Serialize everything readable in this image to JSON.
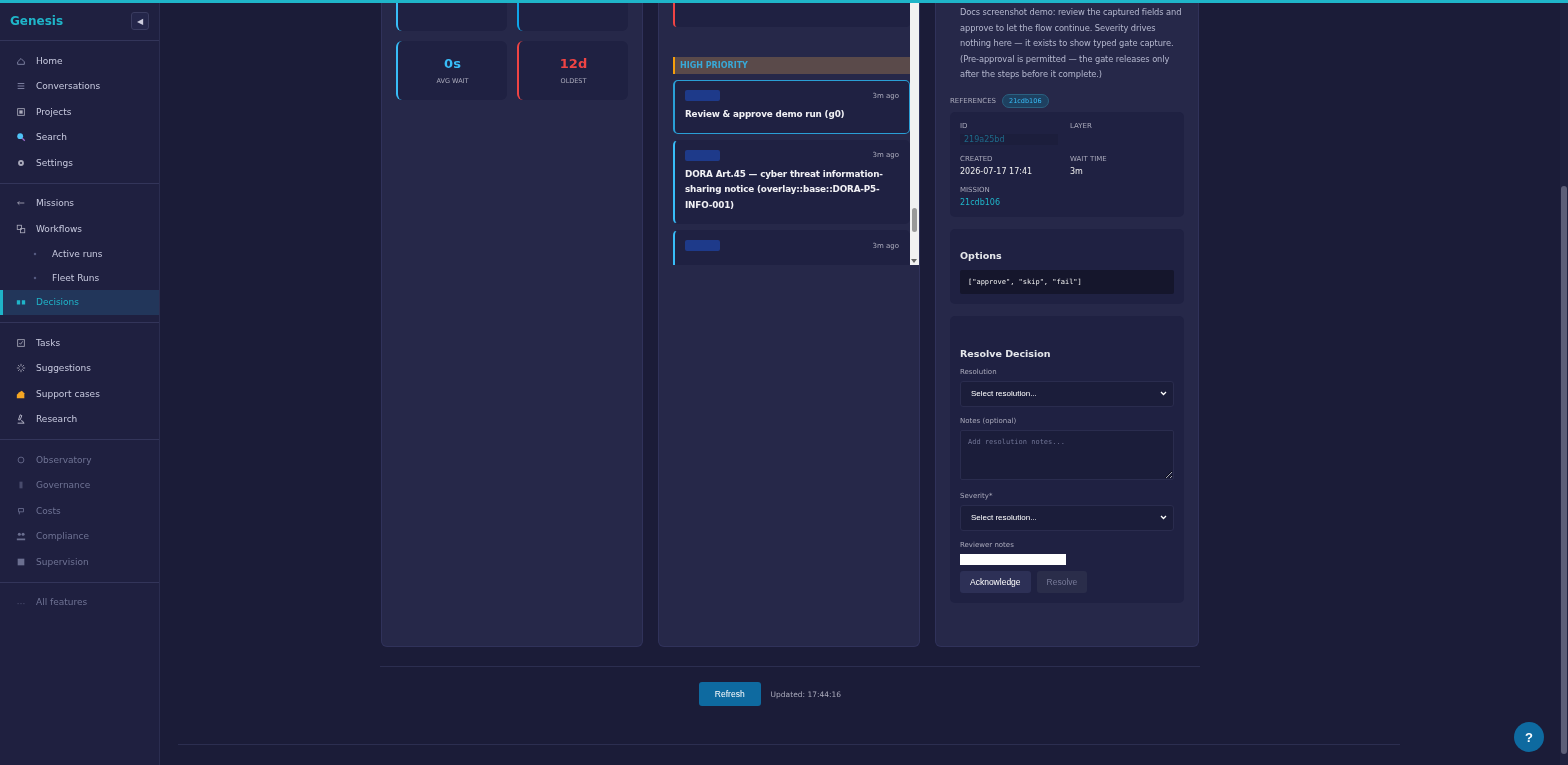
{
  "sidebar": {
    "brand": "Genesis",
    "collapse_glyph": "◀",
    "groups": [
      {
        "items": [
          {
            "label": "Home",
            "selected": false,
            "disabled": false
          },
          {
            "label": "Conversations",
            "selected": false,
            "disabled": false
          },
          {
            "label": "Projects",
            "selected": false,
            "disabled": false
          },
          {
            "label": "Search",
            "selected": false,
            "disabled": false
          },
          {
            "label": "Settings",
            "selected": false,
            "disabled": false
          }
        ]
      },
      {
        "items": [
          {
            "label": "Missions",
            "selected": false,
            "disabled": false
          },
          {
            "label": "Workflows",
            "selected": false,
            "disabled": false,
            "children": [
              {
                "label": "Active runs",
                "selected": false,
                "disabled": false
              },
              {
                "label": "Fleet Runs",
                "selected": false,
                "disabled": false
              }
            ]
          },
          {
            "label": "Decisions",
            "selected": true,
            "disabled": false
          }
        ]
      },
      {
        "items": [
          {
            "label": "Tasks",
            "selected": false,
            "disabled": false
          },
          {
            "label": "Suggestions",
            "selected": false,
            "disabled": false
          },
          {
            "label": "Support cases",
            "selected": false,
            "disabled": false
          },
          {
            "label": "Research",
            "selected": false,
            "disabled": false
          }
        ]
      },
      {
        "items": [
          {
            "label": "Observatory",
            "selected": false,
            "disabled": true
          },
          {
            "label": "Governance",
            "selected": false,
            "disabled": true
          },
          {
            "label": "Costs",
            "selected": false,
            "disabled": true
          },
          {
            "label": "Compliance",
            "selected": false,
            "disabled": true
          },
          {
            "label": "Supervision",
            "selected": false,
            "disabled": true
          }
        ]
      },
      {
        "items": [
          {
            "label": "All features",
            "selected": false,
            "disabled": true
          }
        ]
      }
    ]
  },
  "stats": [
    {
      "value": "0s",
      "label": "AVG WAIT",
      "color": "#38bdf8"
    },
    {
      "value": "12d",
      "label": "OLDEST",
      "color": "#ef4444"
    }
  ],
  "queue": {
    "section": "HIGH PRIORITY",
    "cards": [
      {
        "time": "3m ago",
        "title": "Review & approve demo run (g0)",
        "selected": true
      },
      {
        "time": "3m ago",
        "title": "DORA Art.45 — cyber threat information-sharing notice (overlay::base::DORA-P5-INFO-001)",
        "selected": false
      },
      {
        "time": "3m ago",
        "selected": false
      }
    ]
  },
  "detail": {
    "description": "Docs screenshot demo: review the captured fields and approve to let the flow continue. Severity drives nothing here — it exists to show typed gate capture. (Pre-approval is permitted — the gate releases only after the steps before it complete.)",
    "references_label": "REFERENCES",
    "reference": "21cdb106",
    "fields": [
      {
        "label": "ID",
        "value": "219a25bd",
        "kind": "id"
      },
      {
        "label": "LAYER",
        "kind": "plain"
      },
      {
        "label": "CREATED",
        "value": "2026-07-17 17:41",
        "kind": "plain"
      },
      {
        "label": "WAIT TIME",
        "value": "3m",
        "kind": "plain"
      },
      {
        "label": "MISSION",
        "value": "21cdb106",
        "kind": "link"
      }
    ],
    "options_title": "Options",
    "options_code": "[\"approve\", \"skip\", \"fail\"]",
    "resolve": {
      "title": "Resolve Decision",
      "resolution_label": "Resolution",
      "resolution_value": "Select resolution...",
      "notes_label": "Notes (optional)",
      "notes_placeholder": "Add resolution notes...",
      "severity_label": "Severity*",
      "severity_value": "Select resolution...",
      "reviewer_label": "Reviewer notes",
      "buttons": [
        {
          "label": "Acknowledge",
          "disabled": false
        },
        {
          "label": "Resolve",
          "disabled": true
        }
      ]
    }
  },
  "footer": {
    "refresh": "Refresh",
    "updated": "Updated: 17:44:16"
  },
  "help": "?"
}
